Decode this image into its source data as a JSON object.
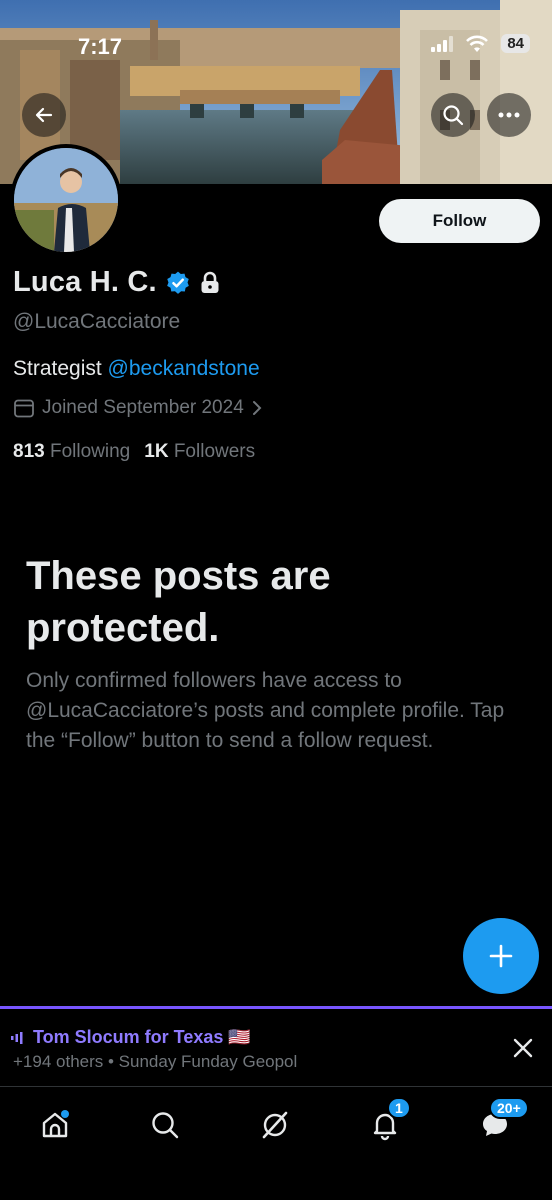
{
  "status_bar": {
    "time": "7:17",
    "battery": "84"
  },
  "profile": {
    "display_name": "Luca H. C.",
    "handle": "@LucaCacciatore",
    "bio_text": "Strategist ",
    "bio_mention": "@beckandstone",
    "joined": "Joined September 2024",
    "following_count": "813",
    "following_label": "Following",
    "followers_count": "1K",
    "followers_label": "Followers",
    "verified": true,
    "protected": true
  },
  "actions": {
    "follow_label": "Follow"
  },
  "protected_notice": {
    "title": "These posts are protected.",
    "body": "Only confirmed followers have access to @LucaCacciatore’s posts and complete profile. Tap the “Follow” button to send a follow request."
  },
  "spaces": {
    "title": "Tom Slocum for Texas 🇺🇸",
    "subtitle": "+194 others • Sunday Funday Geopol"
  },
  "nav": {
    "items": [
      {
        "name": "home",
        "icon": "home-icon"
      },
      {
        "name": "search",
        "icon": "search-icon"
      },
      {
        "name": "grok",
        "icon": "grok-icon"
      },
      {
        "name": "notifications",
        "icon": "bell-icon",
        "badge": "1"
      },
      {
        "name": "messages",
        "icon": "chat-icon",
        "badge": "20+"
      }
    ]
  },
  "colors": {
    "accent": "#1d9bf0",
    "spaces": "#8f7bff",
    "background": "#000000"
  }
}
